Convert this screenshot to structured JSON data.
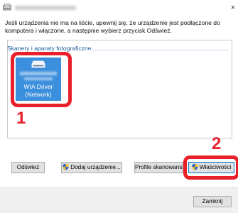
{
  "window": {
    "title": "Skanery i aparaty fotograficzne",
    "close_glyph": "×"
  },
  "instructions": "Jeśli urządzenia nie ma na liście, upewnij się, że urządzenie jest podłączone do komputera i włączone, a następnie wybierz przycisk Odśwież.",
  "device_group": {
    "header": "Skanery i aparaty fotograficzne"
  },
  "device": {
    "name_line1": "WIA Driver",
    "name_line2": "(Network)",
    "icon": "scanner-icon"
  },
  "callouts": {
    "step1": "1",
    "step2": "2",
    "color": "#e8202a"
  },
  "buttons": {
    "refresh": "Odśwież",
    "add_device": "Dodaj urządzenie...",
    "scan_profiles": "Profile skanowania",
    "properties": "Właściwości",
    "close": "Zamknij"
  },
  "colors": {
    "selection": "#3c8fdc",
    "group_header": "#1e5a9a"
  }
}
